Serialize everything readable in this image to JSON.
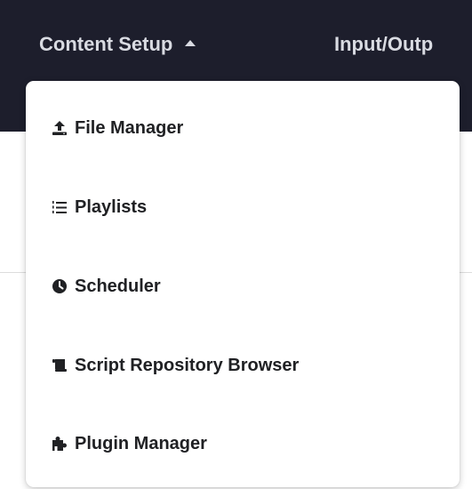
{
  "navbar": {
    "items": [
      {
        "label": "Content Setup"
      },
      {
        "label": "Input/Outp"
      }
    ]
  },
  "dropdown": {
    "items": [
      {
        "label": "File Manager",
        "icon": "upload-icon"
      },
      {
        "label": "Playlists",
        "icon": "list-ol-icon"
      },
      {
        "label": "Scheduler",
        "icon": "clock-icon"
      },
      {
        "label": "Script Repository Browser",
        "icon": "scroll-icon"
      },
      {
        "label": "Plugin Manager",
        "icon": "puzzle-icon"
      }
    ]
  },
  "colors": {
    "navbar_bg": "#1d1e2c",
    "navbar_text": "#d9dbe2",
    "menu_text": "#202124",
    "icon": "#202124"
  }
}
